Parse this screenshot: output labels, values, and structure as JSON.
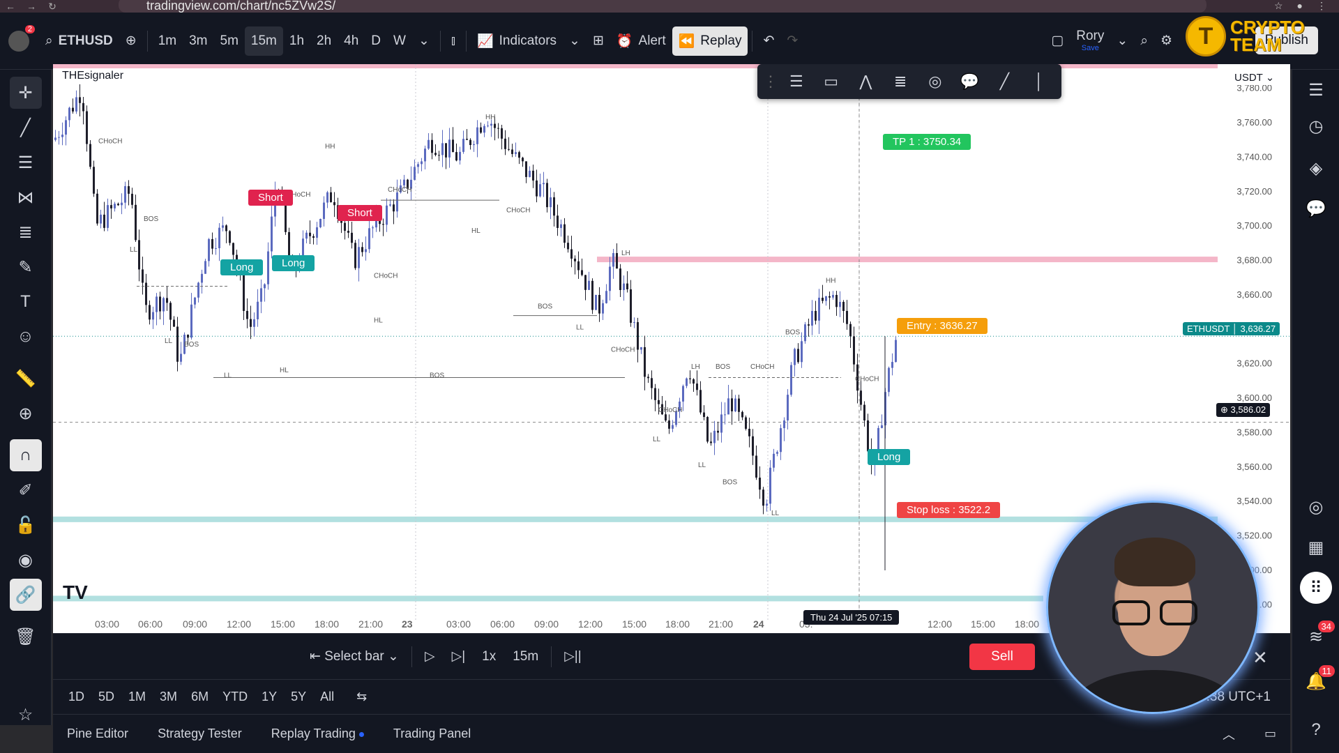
{
  "browser": {
    "url": "tradingview.com/chart/nc5ZVw2S/"
  },
  "toolbar": {
    "notification_count": "2",
    "symbol": "ETHUSD",
    "timeframes": [
      "1m",
      "3m",
      "5m",
      "15m",
      "1h",
      "2h",
      "4h",
      "D",
      "W"
    ],
    "active_timeframe": "15m",
    "indicators_label": "Indicators",
    "alert_label": "Alert",
    "replay_label": "Replay",
    "user_name": "Rory",
    "user_save": "Save",
    "publish_label": "Publish"
  },
  "brand": {
    "line1": "CRYPTO",
    "line2": "TEAM"
  },
  "chart": {
    "indicator_name": "THEsignaler",
    "currency": "USDT",
    "price_axis": [
      "3,780.00",
      "3,760.00",
      "3,740.00",
      "3,720.00",
      "3,700.00",
      "3,680.00",
      "3,660.00",
      "3,640.00",
      "3,620.00",
      "3,600.00",
      "3,580.00",
      "3,560.00",
      "3,540.00",
      "3,520.00",
      "3,500.00",
      "3,480.00"
    ],
    "time_axis": [
      "03:00",
      "06:00",
      "09:00",
      "12:00",
      "15:00",
      "18:00",
      "21:00",
      "23",
      "03:00",
      "06:00",
      "09:00",
      "12:00",
      "15:00",
      "18:00",
      "21:00",
      "24",
      "03:",
      "12:00",
      "15:00",
      "18:00"
    ],
    "crosshair_time": "Thu 24 Jul '25   07:15",
    "last_price_symbol": "ETHUSDT",
    "last_price": "3,636.27",
    "crosshair_price": "3,586.02",
    "tp_label": "TP 1 : 3750.34",
    "entry_label": "Entry : 3636.27",
    "stop_label": "Stop loss : 3522.2",
    "signals": [
      "Short",
      "Short",
      "Long",
      "Long",
      "Long"
    ],
    "structure_labels": [
      "HH",
      "HH",
      "LH",
      "CHoCH",
      "CHoCH",
      "CHoCH",
      "BOS",
      "LL",
      "LL",
      "LL",
      "BOS",
      "HL",
      "HL",
      "CHoCH",
      "HL",
      "CHoCH",
      "BOS",
      "LH",
      "BOS",
      "LL",
      "CHoCH",
      "LL",
      "CHoCH",
      "BOS",
      "LH",
      "CHoCH",
      "HH",
      "CHoCH",
      "BOS",
      "LL",
      "LL",
      "BOS"
    ],
    "colors": {
      "bull": "#5b6abf",
      "bear": "#1e1e2a",
      "tp": "#22c55e",
      "entry": "#f59e0b",
      "stop": "#ef4444",
      "long": "#14a3a3",
      "short": "#e0234e",
      "resistance": "#f4b6c8",
      "support": "#b2e0e0"
    }
  },
  "replay": {
    "select_bar_label": "Select bar",
    "speed": "1x",
    "interval": "15m",
    "sell_label": "Sell"
  },
  "ranges": [
    "1D",
    "5D",
    "1M",
    "3M",
    "6M",
    "YTD",
    "1Y",
    "5Y",
    "All"
  ],
  "timezone": ":38 UTC+1",
  "bottom_tabs": [
    "Pine Editor",
    "Strategy Tester",
    "Replay Trading",
    "Trading Panel"
  ],
  "right_badges": {
    "chat": "34",
    "notifications": "11"
  }
}
